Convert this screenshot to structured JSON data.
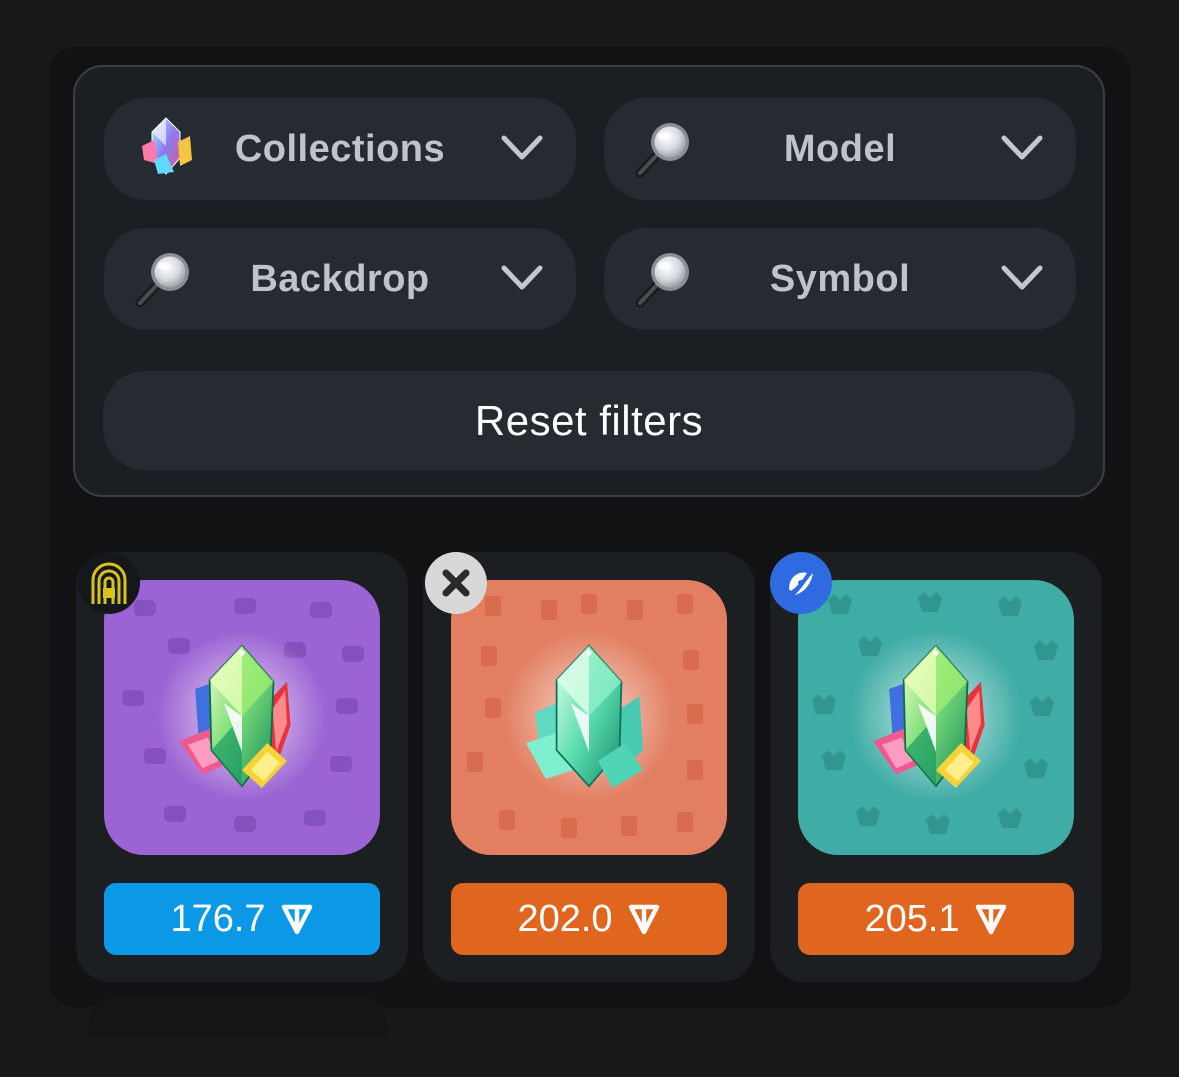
{
  "filters": {
    "collections": {
      "label": "Collections",
      "icon": "gem-cluster-icon"
    },
    "model": {
      "label": "Model",
      "icon": "magnifier-icon"
    },
    "backdrop": {
      "label": "Backdrop",
      "icon": "magnifier-icon"
    },
    "symbol": {
      "label": "Symbol",
      "icon": "magnifier-icon"
    },
    "reset_label": "Reset filters"
  },
  "items": [
    {
      "price": "176.7",
      "currency_icon": "ton-icon",
      "price_color": "#0b98e6",
      "backdrop_color": "#9b63d3",
      "badge_icon": "fingerprint-lock-badge",
      "crystal": "multicolor"
    },
    {
      "price": "202.0",
      "currency_icon": "ton-icon",
      "price_color": "#e0661f",
      "backdrop_color": "#e27f61",
      "badge_icon": "x-badge",
      "crystal": "aqua"
    },
    {
      "price": "205.1",
      "currency_icon": "ton-icon",
      "price_color": "#e0661f",
      "backdrop_color": "#3fada5",
      "badge_icon": "leaf-badge",
      "crystal": "multicolor"
    }
  ]
}
